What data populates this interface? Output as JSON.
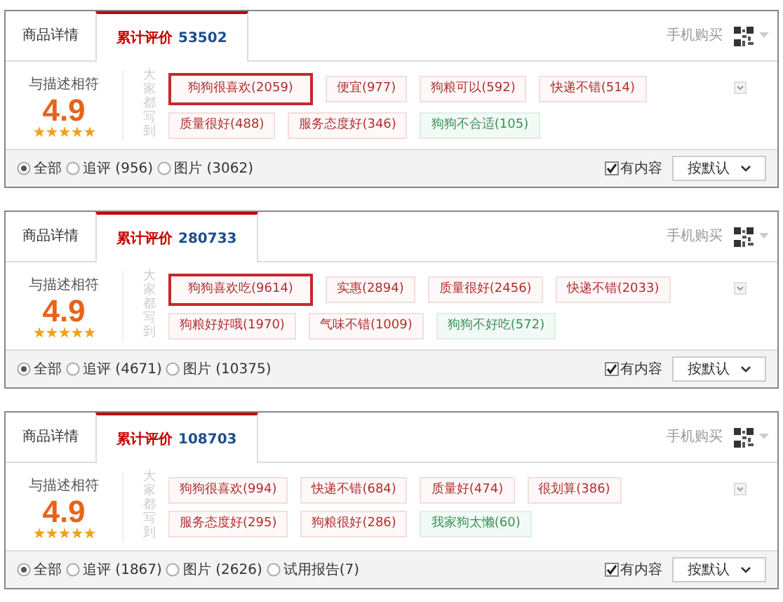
{
  "panels": [
    {
      "tabs": [
        {
          "label": "商品详情",
          "selected": false
        },
        {
          "label": "累计评价",
          "count": "53502",
          "selected": true
        }
      ],
      "mobile_buy": "手机购买",
      "rating": {
        "label": "与描述相符",
        "score": "4.9",
        "stars": 5
      },
      "tags_label": "大家都写到",
      "tags": [
        {
          "text": "狗狗很喜欢(2059)",
          "kind": "positive",
          "highlighted": true
        },
        {
          "text": "便宜(977)",
          "kind": "positive",
          "highlighted": false
        },
        {
          "text": "狗粮可以(592)",
          "kind": "positive",
          "highlighted": false
        },
        {
          "text": "快递不错(514)",
          "kind": "positive",
          "highlighted": false
        },
        {
          "text": "质量很好(488)",
          "kind": "positive",
          "highlighted": false
        },
        {
          "text": "服务态度好(346)",
          "kind": "positive",
          "highlighted": false
        },
        {
          "text": "狗狗不合适(105)",
          "kind": "negative",
          "highlighted": false
        }
      ],
      "filters": [
        {
          "label": "全部",
          "selected": true
        },
        {
          "label": "追评 (956)",
          "selected": false
        },
        {
          "label": "图片 (3062)",
          "selected": false
        }
      ],
      "has_content": {
        "label": "有内容",
        "checked": true
      },
      "sort": "按默认"
    },
    {
      "tabs": [
        {
          "label": "商品详情",
          "selected": false
        },
        {
          "label": "累计评价",
          "count": "280733",
          "selected": true
        }
      ],
      "mobile_buy": "手机购买",
      "rating": {
        "label": "与描述相符",
        "score": "4.9",
        "stars": 5
      },
      "tags_label": "大家都写到",
      "tags": [
        {
          "text": "狗狗喜欢吃(9614)",
          "kind": "positive",
          "highlighted": true
        },
        {
          "text": "实惠(2894)",
          "kind": "positive",
          "highlighted": false
        },
        {
          "text": "质量很好(2456)",
          "kind": "positive",
          "highlighted": false
        },
        {
          "text": "快递不错(2033)",
          "kind": "positive",
          "highlighted": false
        },
        {
          "text": "狗粮好好哦(1970)",
          "kind": "positive",
          "highlighted": false
        },
        {
          "text": "气味不错(1009)",
          "kind": "positive",
          "highlighted": false
        },
        {
          "text": "狗狗不好吃(572)",
          "kind": "negative",
          "highlighted": false
        }
      ],
      "filters": [
        {
          "label": "全部",
          "selected": true
        },
        {
          "label": "追评 (4671)",
          "selected": false
        },
        {
          "label": "图片 (10375)",
          "selected": false
        }
      ],
      "has_content": {
        "label": "有内容",
        "checked": true
      },
      "sort": "按默认"
    },
    {
      "tabs": [
        {
          "label": "商品详情",
          "selected": false
        },
        {
          "label": "累计评价",
          "count": "108703",
          "selected": true
        }
      ],
      "mobile_buy": "手机购买",
      "rating": {
        "label": "与描述相符",
        "score": "4.9",
        "stars": 5
      },
      "tags_label": "大家都写到",
      "tags": [
        {
          "text": "狗狗很喜欢(994)",
          "kind": "positive",
          "highlighted": false
        },
        {
          "text": "快递不错(684)",
          "kind": "positive",
          "highlighted": false
        },
        {
          "text": "质量好(474)",
          "kind": "positive",
          "highlighted": false
        },
        {
          "text": "很划算(386)",
          "kind": "positive",
          "highlighted": false
        },
        {
          "text": "服务态度好(295)",
          "kind": "positive",
          "highlighted": false
        },
        {
          "text": "狗粮很好(286)",
          "kind": "positive",
          "highlighted": false
        },
        {
          "text": "我家狗太懒(60)",
          "kind": "negative",
          "highlighted": false
        }
      ],
      "filters": [
        {
          "label": "全部",
          "selected": true
        },
        {
          "label": "追评 (1867)",
          "selected": false
        },
        {
          "label": "图片 (2626)",
          "selected": false
        },
        {
          "label": "试用报告(7)",
          "selected": false
        }
      ],
      "has_content": {
        "label": "有内容",
        "checked": true
      },
      "sort": "按默认"
    }
  ]
}
